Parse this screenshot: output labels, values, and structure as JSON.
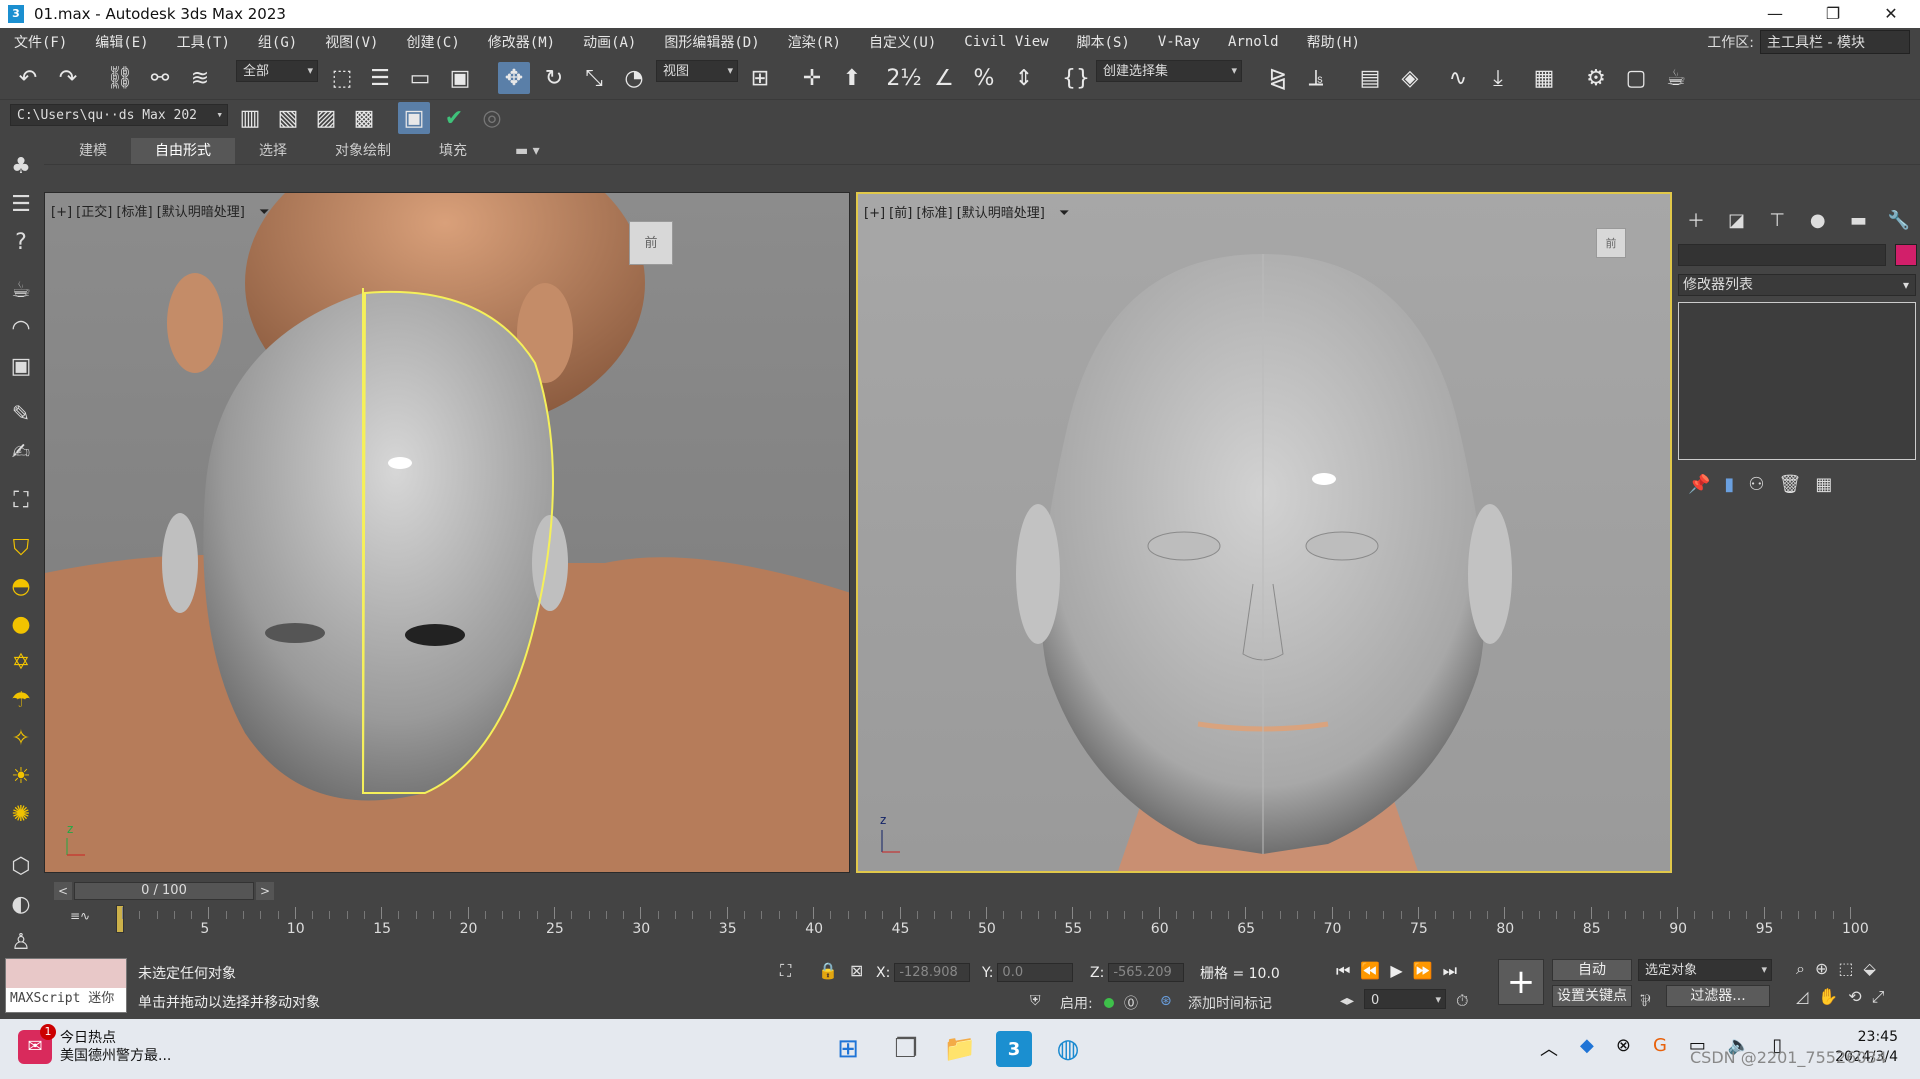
{
  "window": {
    "title": "01.max - Autodesk 3ds Max 2023",
    "app_icon": "3",
    "min": "—",
    "max": "❐",
    "close": "✕"
  },
  "menu": [
    "文件(F)",
    "编辑(E)",
    "工具(T)",
    "组(G)",
    "视图(V)",
    "创建(C)",
    "修改器(M)",
    "动画(A)",
    "图形编辑器(D)",
    "渲染(R)",
    "自定义(U)",
    "Civil View",
    "脚本(S)",
    "V-Ray",
    "Arnold",
    "帮助(H)"
  ],
  "workspace": {
    "label": "工作区:",
    "value": "主工具栏 - 模块"
  },
  "toolbar": {
    "filter_all": "全部",
    "ref_coord": "视图",
    "selection_set": "创建选择集",
    "project_path": "C:\\Users\\qu··ds Max 202"
  },
  "ribbon_tabs": [
    "建模",
    "自由形式",
    "选择",
    "对象绘制",
    "填充"
  ],
  "ribbon_active": "自由形式",
  "viewports": {
    "left": {
      "label": "[+] [正交] [标准] [默认明暗处理]",
      "cube": "前"
    },
    "right": {
      "label": "[+] [前] [标准] [默认明暗处理]",
      "cube": "前"
    }
  },
  "command_panel": {
    "modifier_list": "修改器列表",
    "object_color": "#d21f6a"
  },
  "time_slider": {
    "value": "0 / 100",
    "prev": "<",
    "next": ">"
  },
  "track_ticks": [
    "5",
    "10",
    "15",
    "20",
    "25",
    "30",
    "35",
    "40",
    "45",
    "50",
    "55",
    "60",
    "65",
    "70",
    "75",
    "80",
    "85",
    "90",
    "95",
    "100"
  ],
  "status": {
    "maxscript": "MAXScript 迷你",
    "line1": "未选定任何对象",
    "line2": "单击并拖动以选择并移动对象",
    "x_label": "X:",
    "x_value": "-128.908",
    "y_label": "Y:",
    "y_value": "0.0",
    "z_label": "Z:",
    "z_value": "-565.209",
    "grid": "栅格 = 10.0",
    "enable": "启用:",
    "add_time_tag": "添加时间标记",
    "auto": "自动",
    "set_key": "设置关键点",
    "selected": "选定对象",
    "filters": "过滤器...",
    "frame": "0"
  },
  "taskbar": {
    "news_title": "今日热点",
    "news_sub": "美国德州警方最...",
    "news_badge": "1",
    "time": "23:45",
    "date": "2024/3/4",
    "watermark": "CSDN @2201_75526034"
  }
}
